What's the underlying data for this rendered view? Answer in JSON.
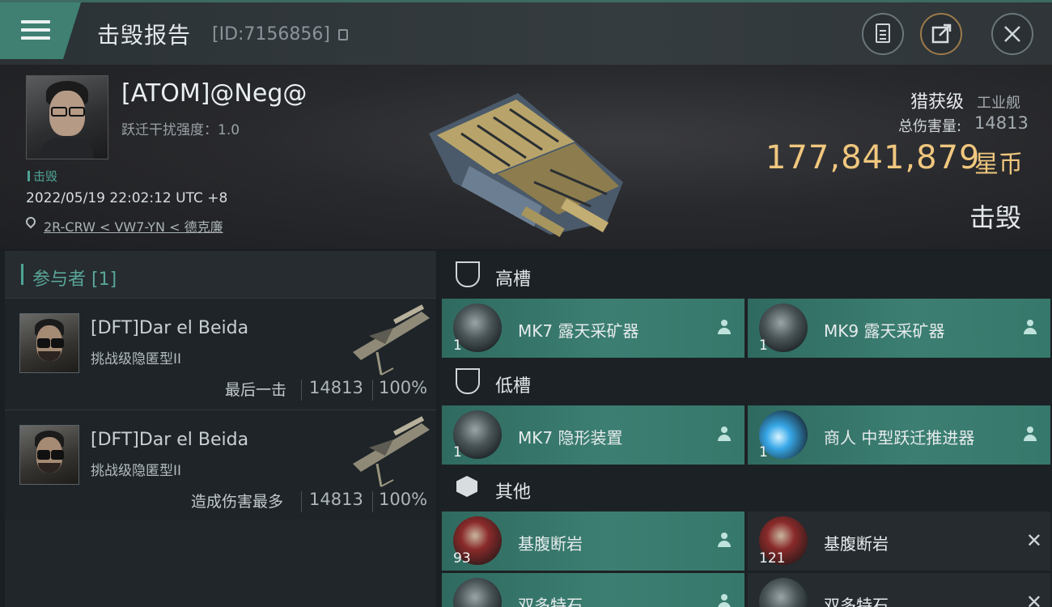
{
  "header": {
    "title": "击毁报告",
    "report_id": "[ID:7156856]"
  },
  "victim": {
    "name": "[ATOM]@Neg@",
    "warp_scramble": "跃迁干扰强度：1.0",
    "tag": "击毁",
    "timestamp": "2022/05/19 22:02:12 UTC +8",
    "location": "2R-CRW < VW7-YN < 德克廉",
    "ship_class": "猎获级",
    "ship_type": "工业舰",
    "damage_label": "总伤害量:",
    "damage_value": "14813",
    "isk_value": "177,841,879",
    "isk_unit": "星币",
    "status": "击毁"
  },
  "participants": {
    "title": "参与者 [1]",
    "items": [
      {
        "name": "[DFT]Dar el Beida",
        "ship": "挑战级隐匿型II",
        "role": "最后一击",
        "damage": "14813",
        "percent": "100%"
      },
      {
        "name": "[DFT]Dar el Beida",
        "ship": "挑战级隐匿型II",
        "role": "造成伤害最多",
        "damage": "14813",
        "percent": "100%"
      }
    ]
  },
  "fitting": {
    "high_title": "高槽",
    "low_title": "低槽",
    "other_title": "其他",
    "high": [
      {
        "name": "MK7 露天采矿器",
        "qty": "1"
      },
      {
        "name": "MK9 露天采矿器",
        "qty": "1"
      }
    ],
    "low": [
      {
        "name": "MK7 隐形装置",
        "qty": "1"
      },
      {
        "name": "商人 中型跃迁推进器",
        "qty": "1"
      }
    ],
    "other": [
      {
        "name": "基腹断岩",
        "qty": "93"
      },
      {
        "name": "基腹断岩",
        "qty": "121"
      },
      {
        "name": "双多特石",
        "qty": ""
      },
      {
        "name": "双多特石",
        "qty": ""
      }
    ]
  },
  "colors": {
    "accent": "#3f8073",
    "isk_gold": "#f0c77e",
    "dropped_slot": "#3c7f72",
    "destroyed_slot": "#252b2f"
  }
}
